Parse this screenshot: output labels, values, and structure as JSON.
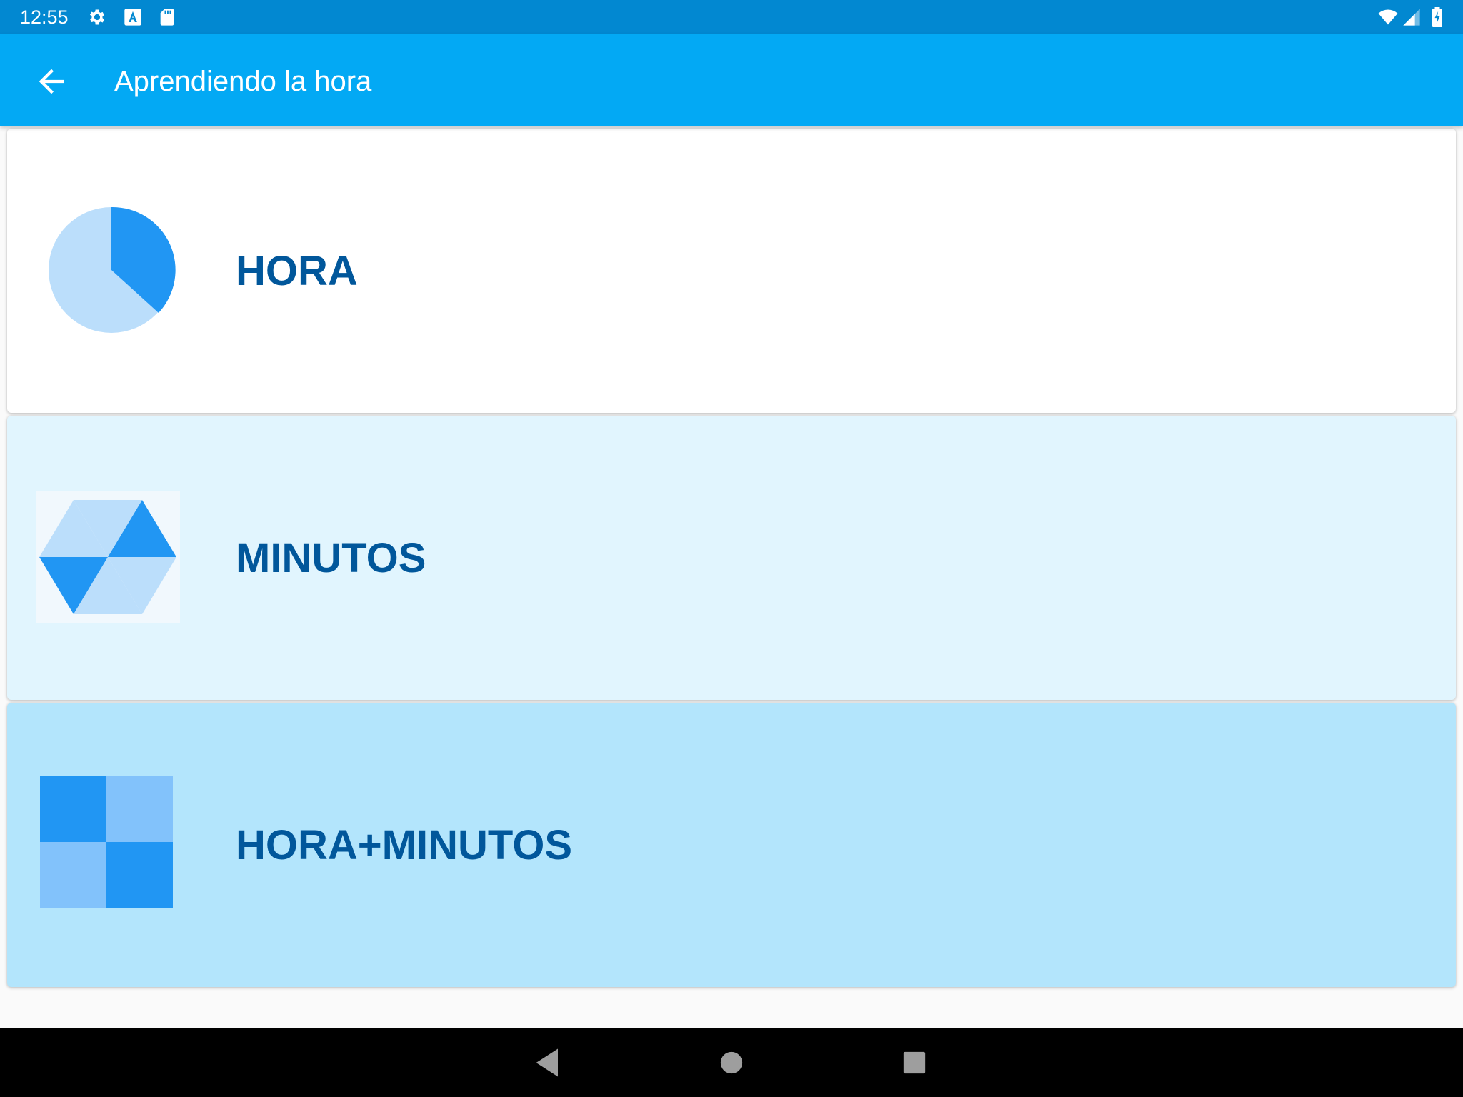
{
  "status_bar": {
    "time": "12:55",
    "left_icons": [
      "gear-icon",
      "font-a-icon",
      "sd-card-icon"
    ],
    "right_icons": [
      "wifi-icon",
      "signal-icon",
      "battery-charging-icon"
    ]
  },
  "app_bar": {
    "back_icon": "arrow-back-icon",
    "title": "Aprendiendo la hora",
    "color": "#03a9f4"
  },
  "menu": {
    "items": [
      {
        "label": "HORA",
        "icon": "pie-chart-icon",
        "background": "#ffffff"
      },
      {
        "label": "MINUTOS",
        "icon": "hexagon-triangles-icon",
        "background": "#e1f5fe"
      },
      {
        "label": "HORA+MINUTOS",
        "icon": "checkerboard-icon",
        "background": "#b3e5fc"
      }
    ]
  },
  "nav_bar": {
    "buttons": [
      "back-triangle-icon",
      "home-circle-icon",
      "recents-square-icon"
    ]
  },
  "colors": {
    "label_text": "#01579b",
    "icon_dark": "#2196f3",
    "icon_light": "#bbdefb",
    "status_bar": "#0288d1"
  }
}
